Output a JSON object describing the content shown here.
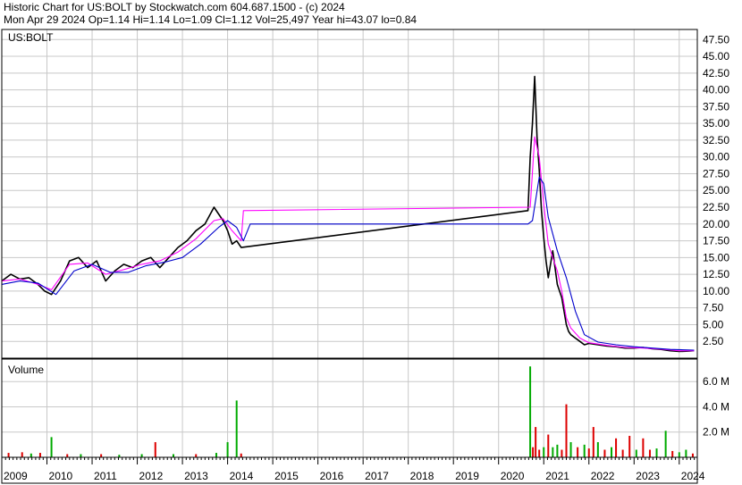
{
  "header": {
    "line1": "Historic Chart for US:BOLT by Stockwatch.com 604.687.1500 - (c) 2024",
    "line2": "Mon Apr 29 2024  Op=1.14  Hi=1.14  Lo=1.09  Cl=1.12  Vol=25,497  Year hi=43.07  lo=0.84"
  },
  "colors": {
    "price": "#000000",
    "ma_short": "#ff00ff",
    "ma_long": "#0000cc",
    "vol_up": "#00aa00",
    "vol_down": "#dd0000",
    "grid": "#c8c8c8",
    "frame": "#000000"
  },
  "chart_data": [
    {
      "type": "line",
      "label": "US:BOLT",
      "x_axis": {
        "labels": [
          "2009",
          "2010",
          "2011",
          "2012",
          "2013",
          "2014",
          "2015",
          "2016",
          "2017",
          "2018",
          "2019",
          "2020",
          "2021",
          "2022",
          "2023",
          "2024"
        ],
        "range": [
          2009.0,
          2024.4
        ]
      },
      "y_axis": {
        "range": [
          0,
          49
        ],
        "ticks": [
          2.5,
          5,
          7.5,
          10,
          12.5,
          15,
          17.5,
          20,
          22.5,
          25,
          27.5,
          30,
          32.5,
          35,
          37.5,
          40,
          42.5,
          45,
          47.5
        ],
        "tick_labels": [
          "2.50",
          "5.00",
          "7.50",
          "10.00",
          "12.50",
          "15.00",
          "17.50",
          "20.00",
          "22.50",
          "25.00",
          "27.50",
          "30.00",
          "32.50",
          "35.00",
          "37.50",
          "40.00",
          "42.50",
          "45.00",
          "47.50"
        ]
      },
      "grid": true,
      "series": [
        {
          "role": "price",
          "x": [
            2009.0,
            2009.2,
            2009.4,
            2009.6,
            2009.8,
            2009.95,
            2010.1,
            2010.3,
            2010.5,
            2010.7,
            2010.9,
            2011.1,
            2011.3,
            2011.5,
            2011.7,
            2011.9,
            2012.1,
            2012.3,
            2012.5,
            2012.7,
            2012.9,
            2013.1,
            2013.3,
            2013.5,
            2013.7,
            2013.9,
            2014.0,
            2014.1,
            2014.2,
            2014.3,
            2020.65,
            2020.7,
            2020.75,
            2020.8,
            2020.85,
            2020.9,
            2020.95,
            2021.0,
            2021.05,
            2021.1,
            2021.2,
            2021.3,
            2021.4,
            2021.5,
            2021.55,
            2021.6,
            2021.7,
            2021.8,
            2021.9,
            2022.0,
            2022.2,
            2022.4,
            2022.6,
            2022.8,
            2023.0,
            2023.2,
            2023.4,
            2023.6,
            2023.8,
            2024.0,
            2024.2,
            2024.33
          ],
          "y": [
            11.5,
            12.5,
            11.8,
            12.0,
            11.0,
            10.0,
            9.5,
            11.5,
            14.5,
            15.0,
            13.5,
            14.5,
            11.5,
            13.0,
            14.0,
            13.5,
            14.5,
            15.0,
            13.5,
            15.0,
            16.5,
            17.5,
            19.0,
            20.0,
            22.5,
            20.5,
            19.0,
            17.0,
            17.5,
            16.5,
            22.0,
            30.0,
            35.0,
            42.0,
            33.0,
            28.0,
            22.0,
            18.0,
            14.5,
            12.0,
            16.0,
            11.0,
            9.0,
            5.0,
            4.0,
            3.5,
            3.0,
            2.5,
            2.0,
            2.2,
            2.0,
            1.8,
            1.7,
            1.5,
            1.5,
            1.6,
            1.4,
            1.3,
            1.1,
            1.0,
            1.05,
            1.12
          ]
        },
        {
          "role": "ma_short",
          "x": [
            2009.0,
            2009.4,
            2009.8,
            2010.1,
            2010.5,
            2010.9,
            2011.3,
            2011.7,
            2012.1,
            2012.5,
            2012.9,
            2013.3,
            2013.7,
            2013.9,
            2014.1,
            2014.3,
            2014.35,
            2020.7,
            2020.8,
            2020.9,
            2021.0,
            2021.1,
            2021.2,
            2021.3,
            2021.4,
            2021.5,
            2021.6,
            2021.8,
            2022.0,
            2022.4,
            2022.8,
            2023.2,
            2023.6,
            2024.0,
            2024.33
          ],
          "y": [
            11.5,
            11.8,
            11.0,
            10.2,
            14.0,
            14.2,
            12.5,
            13.2,
            14.0,
            14.5,
            15.8,
            17.8,
            20.5,
            20.8,
            19.0,
            17.5,
            22.0,
            22.5,
            33.0,
            30.0,
            23.0,
            17.0,
            15.0,
            13.0,
            10.0,
            6.0,
            4.5,
            3.0,
            2.3,
            1.9,
            1.6,
            1.5,
            1.35,
            1.1,
            1.1
          ]
        },
        {
          "role": "ma_long",
          "x": [
            2009.0,
            2009.4,
            2009.8,
            2010.2,
            2010.6,
            2011.0,
            2011.4,
            2011.8,
            2012.2,
            2012.6,
            2013.0,
            2013.4,
            2013.8,
            2014.0,
            2014.2,
            2014.35,
            2014.5,
            2020.65,
            2020.75,
            2020.9,
            2021.0,
            2021.1,
            2021.3,
            2021.5,
            2021.7,
            2021.9,
            2022.2,
            2022.6,
            2023.0,
            2023.4,
            2023.8,
            2024.33
          ],
          "y": [
            11.0,
            11.5,
            11.2,
            9.5,
            13.0,
            14.0,
            12.8,
            12.8,
            13.8,
            14.3,
            15.0,
            17.0,
            19.5,
            20.5,
            19.5,
            17.5,
            20.0,
            20.0,
            20.5,
            27.0,
            26.0,
            21.0,
            16.0,
            12.0,
            7.0,
            3.5,
            2.4,
            2.0,
            1.7,
            1.5,
            1.3,
            1.2
          ]
        }
      ]
    },
    {
      "type": "bar",
      "label": "Volume",
      "y_axis": {
        "range": [
          0,
          7.5
        ],
        "ticks": [
          2,
          4,
          6
        ],
        "tick_labels": [
          "2.0 M",
          "4.0 M",
          "6.0 M"
        ]
      },
      "bars": [
        {
          "x": 2009.15,
          "value": 0.35,
          "dir": "down"
        },
        {
          "x": 2009.45,
          "value": 0.4,
          "dir": "down"
        },
        {
          "x": 2009.65,
          "value": 0.3,
          "dir": "up"
        },
        {
          "x": 2009.85,
          "value": 0.35,
          "dir": "down"
        },
        {
          "x": 2010.1,
          "value": 1.6,
          "dir": "up"
        },
        {
          "x": 2010.45,
          "value": 0.25,
          "dir": "down"
        },
        {
          "x": 2010.75,
          "value": 0.25,
          "dir": "up"
        },
        {
          "x": 2011.2,
          "value": 0.25,
          "dir": "down"
        },
        {
          "x": 2011.6,
          "value": 0.2,
          "dir": "up"
        },
        {
          "x": 2012.1,
          "value": 0.25,
          "dir": "up"
        },
        {
          "x": 2012.4,
          "value": 1.2,
          "dir": "down"
        },
        {
          "x": 2012.8,
          "value": 0.25,
          "dir": "up"
        },
        {
          "x": 2013.3,
          "value": 0.25,
          "dir": "down"
        },
        {
          "x": 2013.75,
          "value": 0.35,
          "dir": "up"
        },
        {
          "x": 2014.0,
          "value": 1.2,
          "dir": "up"
        },
        {
          "x": 2014.2,
          "value": 4.5,
          "dir": "up"
        },
        {
          "x": 2014.3,
          "value": 0.3,
          "dir": "down"
        },
        {
          "x": 2020.7,
          "value": 7.2,
          "dir": "up"
        },
        {
          "x": 2020.76,
          "value": 0.8,
          "dir": "down"
        },
        {
          "x": 2020.82,
          "value": 2.4,
          "dir": "down"
        },
        {
          "x": 2020.9,
          "value": 0.6,
          "dir": "down"
        },
        {
          "x": 2021.0,
          "value": 0.8,
          "dir": "up"
        },
        {
          "x": 2021.1,
          "value": 1.8,
          "dir": "down"
        },
        {
          "x": 2021.2,
          "value": 0.8,
          "dir": "up"
        },
        {
          "x": 2021.3,
          "value": 1.0,
          "dir": "up"
        },
        {
          "x": 2021.4,
          "value": 0.6,
          "dir": "down"
        },
        {
          "x": 2021.5,
          "value": 4.2,
          "dir": "down"
        },
        {
          "x": 2021.6,
          "value": 1.2,
          "dir": "up"
        },
        {
          "x": 2021.75,
          "value": 0.8,
          "dir": "down"
        },
        {
          "x": 2021.9,
          "value": 1.0,
          "dir": "up"
        },
        {
          "x": 2022.0,
          "value": 0.7,
          "dir": "down"
        },
        {
          "x": 2022.1,
          "value": 2.4,
          "dir": "down"
        },
        {
          "x": 2022.2,
          "value": 1.2,
          "dir": "up"
        },
        {
          "x": 2022.35,
          "value": 0.6,
          "dir": "down"
        },
        {
          "x": 2022.5,
          "value": 0.8,
          "dir": "up"
        },
        {
          "x": 2022.6,
          "value": 1.5,
          "dir": "down"
        },
        {
          "x": 2022.75,
          "value": 0.6,
          "dir": "down"
        },
        {
          "x": 2022.9,
          "value": 1.7,
          "dir": "down"
        },
        {
          "x": 2023.05,
          "value": 0.6,
          "dir": "up"
        },
        {
          "x": 2023.2,
          "value": 1.5,
          "dir": "down"
        },
        {
          "x": 2023.35,
          "value": 0.6,
          "dir": "down"
        },
        {
          "x": 2023.5,
          "value": 0.7,
          "dir": "up"
        },
        {
          "x": 2023.7,
          "value": 2.1,
          "dir": "up"
        },
        {
          "x": 2023.85,
          "value": 0.5,
          "dir": "down"
        },
        {
          "x": 2024.0,
          "value": 0.4,
          "dir": "up"
        },
        {
          "x": 2024.15,
          "value": 0.6,
          "dir": "up"
        },
        {
          "x": 2024.3,
          "value": 0.3,
          "dir": "down"
        }
      ]
    }
  ]
}
